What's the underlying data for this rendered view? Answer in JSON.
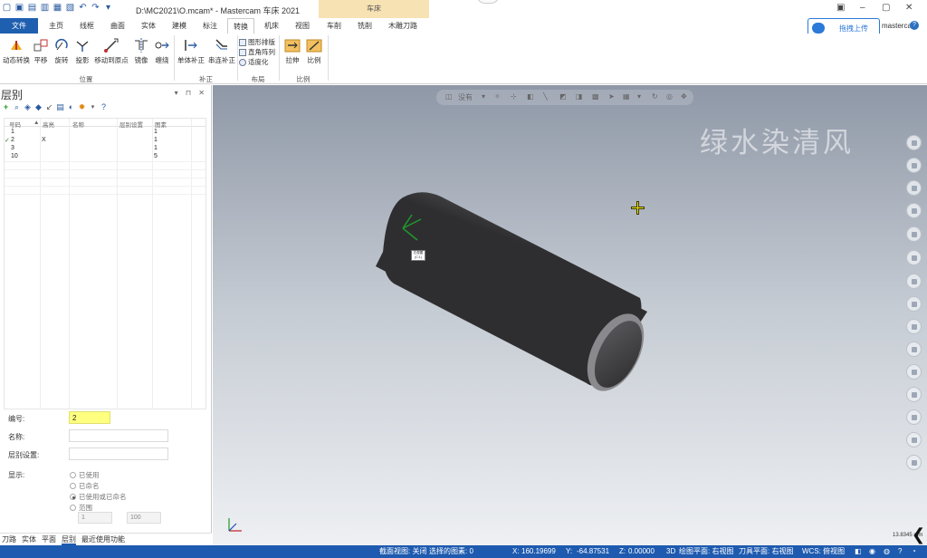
{
  "window": {
    "title": "D:\\MC2021\\O.mcam* - Mastercam 车床 2021",
    "context_tab_group": "车床",
    "account_label": "mastercam",
    "upload_button_label": "拖拽上传"
  },
  "ribbon": {
    "tabs": [
      "文件",
      "主页",
      "线框",
      "曲面",
      "实体",
      "建模",
      "标注",
      "转换",
      "机床",
      "视图",
      "车削",
      "铣削",
      "木雕刀路"
    ],
    "active_tab": "转换",
    "groups": {
      "position": {
        "label": "位置",
        "buttons": [
          "动态转换",
          "平移",
          "旋转",
          "投影",
          "移动到原点",
          "镜像",
          "缠绕"
        ]
      },
      "compensation": {
        "label": "补正",
        "buttons": [
          "单体补正",
          "串连补正"
        ]
      },
      "layout": {
        "label": "布局",
        "buttons": [
          "图形排版",
          "直角阵列",
          "适度化"
        ]
      },
      "scale": {
        "label": "比例",
        "buttons": [
          "拉伸",
          "比例"
        ]
      }
    }
  },
  "layers_panel": {
    "title": "层别",
    "controls": "▾ ⊓ ✕",
    "columns": [
      "号码",
      "高亮",
      "名称",
      "层别设置",
      "图素"
    ],
    "rows": [
      {
        "check": "",
        "number": "1",
        "highlight": "",
        "count": "1"
      },
      {
        "check": "✓",
        "number": "2",
        "highlight": "X",
        "count": "1"
      },
      {
        "check": "",
        "number": "3",
        "highlight": "",
        "count": "1"
      },
      {
        "check": "",
        "number": "10",
        "highlight": "",
        "count": "5"
      }
    ],
    "form": {
      "number_label": "编号:",
      "number_value": "2",
      "name_label": "名称:",
      "name_value": "",
      "set_label": "层别设置:",
      "set_value": "",
      "display_label": "显示:",
      "display_options": [
        "已使用",
        "已命名",
        "已使用或已命名",
        "范围"
      ],
      "selected_display": "已使用或已命名",
      "range_from": "1",
      "range_to": "100"
    },
    "bottom_tabs": [
      "刀路",
      "实体",
      "平面",
      "层别",
      "最近使用功能"
    ]
  },
  "viewport": {
    "toolbar_label": "没有",
    "watermark": "绿水染清风",
    "axis_tag": "右视图\n(C:1)",
    "scale_label": "13.8345 mm"
  },
  "statusbar": {
    "section_view": "截面视图: 关闭",
    "selected": "选择的图素: 0",
    "x_label": "X:",
    "x_value": "160.19699",
    "y_label": "Y:",
    "y_value": "-64.87531",
    "z_label": "Z:",
    "z_value": "0.00000",
    "mode": "3D",
    "drawing_plane": "绘图平面: 右视图",
    "tool_plane": "刀具平面: 右视图",
    "wcs": "WCS: 俯视图"
  },
  "colors": {
    "file_tab": "#1f5fb0",
    "statusbar": "#1e5bb0",
    "context_tab": "#f7e2b4",
    "number_field_highlight": "#ffff80"
  }
}
